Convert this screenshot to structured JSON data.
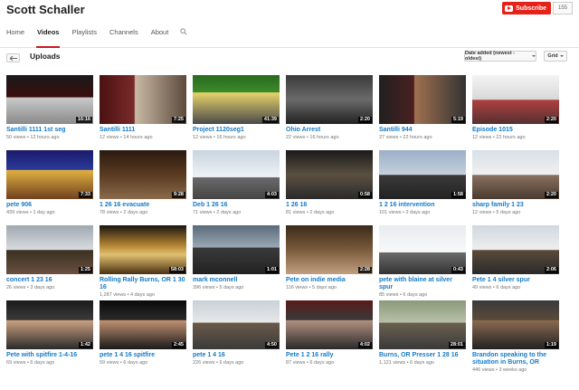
{
  "channel": {
    "title": "Scott Schaller",
    "subscribe_label": "Subscribe",
    "subscriber_count": "155"
  },
  "tabs": [
    {
      "label": "Home"
    },
    {
      "label": "Videos"
    },
    {
      "label": "Playlists"
    },
    {
      "label": "Channels"
    },
    {
      "label": "About"
    }
  ],
  "toolbar": {
    "section_title": "Uploads",
    "sort_label": "Date added (newest - oldest)",
    "view_label": "Grid"
  },
  "icons": {
    "search": "search-icon",
    "back": "back-arrow-icon",
    "subscribe": "youtube-play-icon"
  },
  "colors": {
    "accent": "#cc181e",
    "link": "#167ac6",
    "subscribe": "#e62117"
  },
  "videos": [
    {
      "title": "Santilli 1111 1st seg",
      "duration": "16:16",
      "views": "50 views",
      "age": "12 hours ago"
    },
    {
      "title": "Santilli 1111",
      "duration": "7:25",
      "views": "12 views",
      "age": "14 hours ago"
    },
    {
      "title": "Project 1120seg1",
      "duration": "41:39",
      "views": "12 views",
      "age": "16 hours ago"
    },
    {
      "title": "Ohio Arrest",
      "duration": "2:20",
      "views": "22 views",
      "age": "16 hours ago"
    },
    {
      "title": "Santilli 944",
      "duration": "5:19",
      "views": "27 views",
      "age": "22 hours ago"
    },
    {
      "title": "Episode 1015",
      "duration": "2:20",
      "views": "12 views",
      "age": "22 hours ago"
    },
    {
      "title": "pete 906",
      "duration": "7:33",
      "views": "439 views",
      "age": "1 day ago"
    },
    {
      "title": "1 26 16 evacuate",
      "duration": "9:28",
      "views": "78 views",
      "age": "2 days ago"
    },
    {
      "title": "Deb 1 26 16",
      "duration": "4:03",
      "views": "71 views",
      "age": "2 days ago"
    },
    {
      "title": "1 26 16",
      "duration": "0:58",
      "views": "81 views",
      "age": "2 days ago"
    },
    {
      "title": "1 2 16 intervention",
      "duration": "1:58",
      "views": "101 views",
      "age": "2 days ago"
    },
    {
      "title": "sharp family 1 23",
      "duration": "2:20",
      "views": "12 views",
      "age": "5 days ago"
    },
    {
      "title": "concert 1 23 16",
      "duration": "1:25",
      "views": "26 views",
      "age": "3 days ago"
    },
    {
      "title": "Rolling Rally Burns, OR 1 30 16",
      "duration": "58:03",
      "views": "1,287 views",
      "age": "4 days ago"
    },
    {
      "title": "mark mconnell",
      "duration": "1:01",
      "views": "396 views",
      "age": "5 days ago"
    },
    {
      "title": "Pete on indie media",
      "duration": "2:28",
      "views": "116 views",
      "age": "5 days ago"
    },
    {
      "title": "pete with blaine at silver spur",
      "duration": "0:43",
      "views": "85 views",
      "age": "6 days ago"
    },
    {
      "title": "Pete 1 4 silver spur",
      "duration": "2:06",
      "views": "49 views",
      "age": "6 days ago"
    },
    {
      "title": "Pete with spitfire 1-4-16",
      "duration": "1:42",
      "views": "69 views",
      "age": "6 days ago"
    },
    {
      "title": "pete 1 4 16 spitfire",
      "duration": "2:45",
      "views": "59 views",
      "age": "6 days ago"
    },
    {
      "title": "pete 1 4 16",
      "duration": "4:50",
      "views": "226 views",
      "age": "6 days ago"
    },
    {
      "title": "Pete 1 2 16 rally",
      "duration": "4:02",
      "views": "87 views",
      "age": "6 days ago"
    },
    {
      "title": "Burns, OR Presser 1 28 16",
      "duration": "28:01",
      "views": "1,121 views",
      "age": "6 days ago"
    },
    {
      "title": "Brandon speaking to the situation in Burns, OR",
      "duration": "1:19",
      "views": "446 views",
      "age": "3 weeks ago"
    }
  ]
}
